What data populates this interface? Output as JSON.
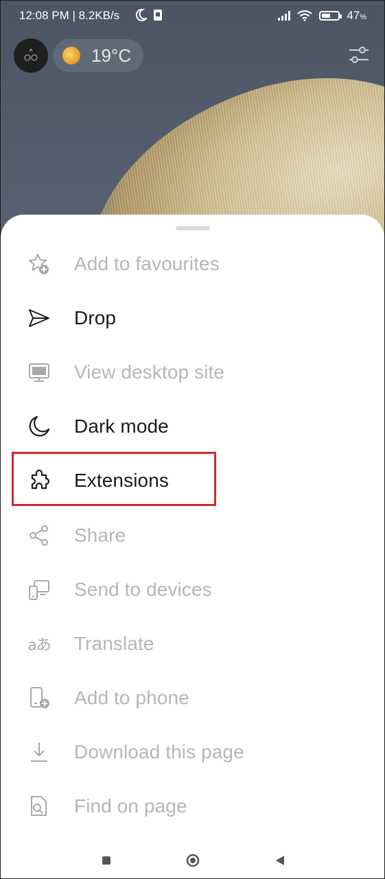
{
  "status_bar": {
    "time_speed": "12:08 PM | 8.2KB/s",
    "battery_percent": "47"
  },
  "header": {
    "temperature": "19°C"
  },
  "menu": {
    "items": [
      {
        "label": "Add to favourites",
        "icon": "star-add-icon",
        "enabled": false
      },
      {
        "label": "Drop",
        "icon": "send-icon",
        "enabled": true
      },
      {
        "label": "View desktop site",
        "icon": "monitor-icon",
        "enabled": false
      },
      {
        "label": "Dark mode",
        "icon": "moon-icon",
        "enabled": true
      },
      {
        "label": "Extensions",
        "icon": "puzzle-icon",
        "enabled": true,
        "highlighted": true
      },
      {
        "label": "Share",
        "icon": "share-icon",
        "enabled": false
      },
      {
        "label": "Send to devices",
        "icon": "devices-icon",
        "enabled": false
      },
      {
        "label": "Translate",
        "icon": "translate-icon",
        "enabled": false
      },
      {
        "label": "Add to phone",
        "icon": "phone-add-icon",
        "enabled": false
      },
      {
        "label": "Download this page",
        "icon": "download-icon",
        "enabled": false
      },
      {
        "label": "Find on page",
        "icon": "find-on-page-icon",
        "enabled": false
      }
    ]
  },
  "colors": {
    "enabled_text": "#1a1a1a",
    "disabled_text": "#b6b6b6",
    "highlight_border": "#d7262e"
  }
}
